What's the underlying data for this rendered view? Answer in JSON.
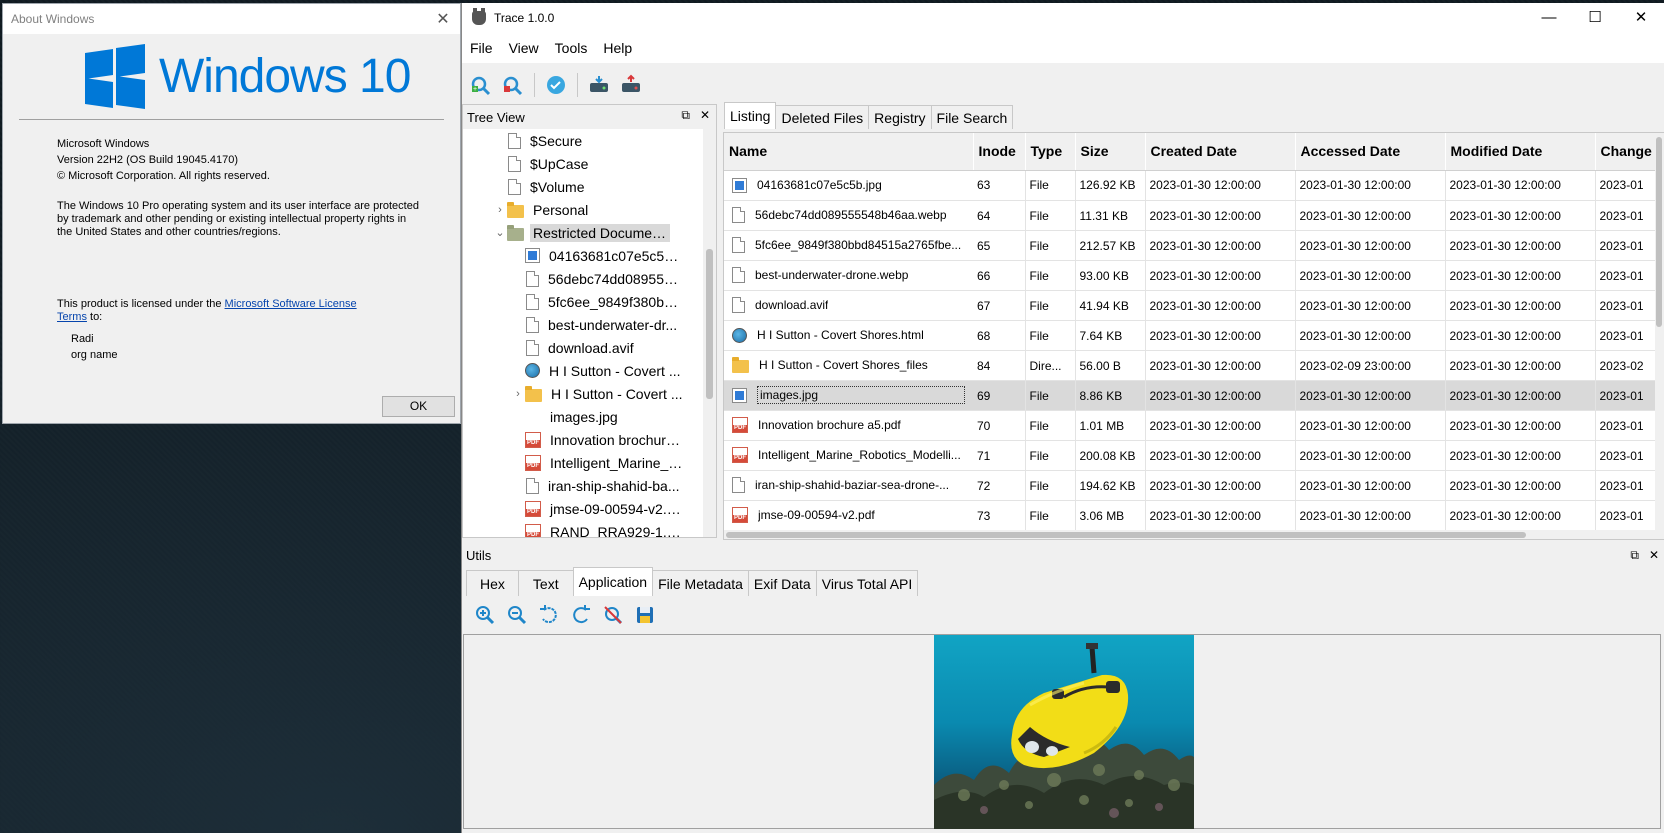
{
  "about": {
    "title": "About Windows",
    "logo_text": "Windows 10",
    "os_name": "Microsoft Windows",
    "version": "Version 22H2 (OS Build 19045.4170)",
    "copyright": "© Microsoft Corporation. All rights reserved.",
    "legal": "The Windows 10 Pro operating system and its user interface are protected by trademark and other pending or existing intellectual property rights in the United States and other countries/regions.",
    "license_prefix": "This product is licensed under the ",
    "license_link": "Microsoft Software License Terms",
    "license_suffix": " to:",
    "user_name": "Radi",
    "org_name": "org name",
    "ok_label": "OK"
  },
  "app": {
    "title": "Trace 1.0.0",
    "menu": [
      "File",
      "View",
      "Tools",
      "Help"
    ],
    "toolbar_icons": [
      "add-evidence-icon",
      "remove-evidence-icon",
      "verify-icon",
      "mount-disk-icon",
      "unmount-disk-icon"
    ]
  },
  "tree": {
    "title": "Tree View",
    "items": [
      {
        "label": "$Secure",
        "icon": "doc",
        "level": 1
      },
      {
        "label": "$UpCase",
        "icon": "doc",
        "level": 1
      },
      {
        "label": "$Volume",
        "icon": "doc",
        "level": 1
      },
      {
        "label": "Personal",
        "icon": "folder",
        "level": 1,
        "arrow": "›"
      },
      {
        "label": "Restricted Documents",
        "icon": "folder-gray",
        "level": 1,
        "arrow": "⌄",
        "selected": true
      },
      {
        "label": "04163681c07e5c5b.j...",
        "icon": "img",
        "level": 2
      },
      {
        "label": "56debc74dd089555...",
        "icon": "doc",
        "level": 2
      },
      {
        "label": "5fc6ee_9849f380bb...",
        "icon": "doc",
        "level": 2
      },
      {
        "label": "best-underwater-dr...",
        "icon": "doc",
        "level": 2
      },
      {
        "label": "download.avif",
        "icon": "doc",
        "level": 2
      },
      {
        "label": "H I Sutton - Covert ...",
        "icon": "web",
        "level": 2
      },
      {
        "label": "H I Sutton - Covert ...",
        "icon": "folder",
        "level": 2,
        "arrow": "›"
      },
      {
        "label": "images.jpg",
        "icon": "none",
        "level": 2
      },
      {
        "label": "Innovation brochure...",
        "icon": "pdf",
        "level": 2
      },
      {
        "label": "Intelligent_Marine_R...",
        "icon": "pdf",
        "level": 2
      },
      {
        "label": "iran-ship-shahid-ba...",
        "icon": "doc",
        "level": 2
      },
      {
        "label": "jmse-09-00594-v2.p...",
        "icon": "pdf",
        "level": 2
      },
      {
        "label": "RAND_RRA929-1.pdf",
        "icon": "pdf",
        "level": 2
      }
    ]
  },
  "tabs": [
    "Listing",
    "Deleted Files",
    "Registry",
    "File Search"
  ],
  "listing": {
    "columns": [
      "Name",
      "Inode",
      "Type",
      "Size",
      "Created Date",
      "Accessed Date",
      "Modified Date",
      "Change"
    ],
    "rows": [
      {
        "icon": "img",
        "name": "04163681c07e5c5b.jpg",
        "inode": "63",
        "type": "File",
        "size": "126.92 KB",
        "created": "2023-01-30 12:00:00",
        "accessed": "2023-01-30 12:00:00",
        "modified": "2023-01-30 12:00:00",
        "changed": "2023-01"
      },
      {
        "icon": "doc",
        "name": "56debc74dd089555548b46aa.webp",
        "inode": "64",
        "type": "File",
        "size": "11.31 KB",
        "created": "2023-01-30 12:00:00",
        "accessed": "2023-01-30 12:00:00",
        "modified": "2023-01-30 12:00:00",
        "changed": "2023-01"
      },
      {
        "icon": "doc",
        "name": "5fc6ee_9849f380bbd84515a2765fbe...",
        "inode": "65",
        "type": "File",
        "size": "212.57 KB",
        "created": "2023-01-30 12:00:00",
        "accessed": "2023-01-30 12:00:00",
        "modified": "2023-01-30 12:00:00",
        "changed": "2023-01"
      },
      {
        "icon": "doc",
        "name": "best-underwater-drone.webp",
        "inode": "66",
        "type": "File",
        "size": "93.00 KB",
        "created": "2023-01-30 12:00:00",
        "accessed": "2023-01-30 12:00:00",
        "modified": "2023-01-30 12:00:00",
        "changed": "2023-01"
      },
      {
        "icon": "doc",
        "name": "download.avif",
        "inode": "67",
        "type": "File",
        "size": "41.94 KB",
        "created": "2023-01-30 12:00:00",
        "accessed": "2023-01-30 12:00:00",
        "modified": "2023-01-30 12:00:00",
        "changed": "2023-01"
      },
      {
        "icon": "web",
        "name": "H I Sutton - Covert Shores.html",
        "inode": "68",
        "type": "File",
        "size": "7.64 KB",
        "created": "2023-01-30 12:00:00",
        "accessed": "2023-01-30 12:00:00",
        "modified": "2023-01-30 12:00:00",
        "changed": "2023-01"
      },
      {
        "icon": "folder",
        "name": "H I Sutton - Covert Shores_files",
        "inode": "84",
        "type": "Dire...",
        "size": "56.00 B",
        "created": "2023-01-30 12:00:00",
        "accessed": "2023-02-09 23:00:00",
        "modified": "2023-01-30 12:00:00",
        "changed": "2023-02"
      },
      {
        "icon": "img",
        "name": "images.jpg",
        "inode": "69",
        "type": "File",
        "size": "8.86 KB",
        "created": "2023-01-30 12:00:00",
        "accessed": "2023-01-30 12:00:00",
        "modified": "2023-01-30 12:00:00",
        "changed": "2023-01",
        "selected": true
      },
      {
        "icon": "pdf",
        "name": "Innovation brochure a5.pdf",
        "inode": "70",
        "type": "File",
        "size": "1.01 MB",
        "created": "2023-01-30 12:00:00",
        "accessed": "2023-01-30 12:00:00",
        "modified": "2023-01-30 12:00:00",
        "changed": "2023-01"
      },
      {
        "icon": "pdf",
        "name": "Intelligent_Marine_Robotics_Modelli...",
        "inode": "71",
        "type": "File",
        "size": "200.08 KB",
        "created": "2023-01-30 12:00:00",
        "accessed": "2023-01-30 12:00:00",
        "modified": "2023-01-30 12:00:00",
        "changed": "2023-01"
      },
      {
        "icon": "doc",
        "name": "iran-ship-shahid-baziar-sea-drone-...",
        "inode": "72",
        "type": "File",
        "size": "194.62 KB",
        "created": "2023-01-30 12:00:00",
        "accessed": "2023-01-30 12:00:00",
        "modified": "2023-01-30 12:00:00",
        "changed": "2023-01"
      },
      {
        "icon": "pdf",
        "name": "jmse-09-00594-v2.pdf",
        "inode": "73",
        "type": "File",
        "size": "3.06 MB",
        "created": "2023-01-30 12:00:00",
        "accessed": "2023-01-30 12:00:00",
        "modified": "2023-01-30 12:00:00",
        "changed": "2023-01"
      }
    ]
  },
  "utils": {
    "title": "Utils",
    "tabs": [
      "Hex",
      "Text",
      "Application",
      "File Metadata",
      "Exif Data",
      "Virus Total API"
    ],
    "active_tab": "Application",
    "image_tools": [
      "zoom-in-icon",
      "zoom-out-icon",
      "rotate-left-icon",
      "rotate-right-icon",
      "reset-view-icon",
      "save-icon"
    ]
  }
}
